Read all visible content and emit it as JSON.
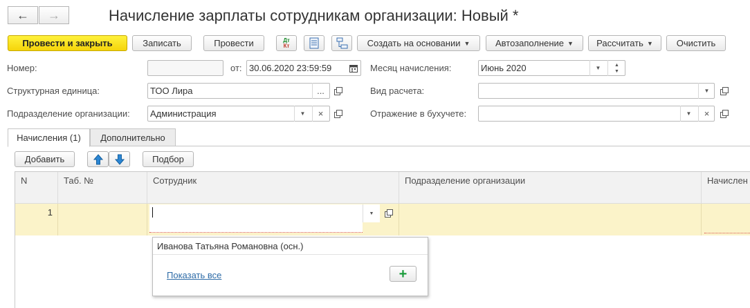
{
  "title": "Начисление зарплаты сотрудникам организации: Новый *",
  "toolbar": {
    "post_close": "Провести и закрыть",
    "save": "Записать",
    "post": "Провести",
    "dt_kt": "Дт Кт",
    "create_based": "Создать на основании",
    "autofill": "Автозаполнение",
    "calculate": "Рассчитать",
    "clear": "Очистить"
  },
  "fields": {
    "number_label": "Номер:",
    "number_value": "",
    "from_label": "от:",
    "date_value": "30.06.2020 23:59:59",
    "month_label": "Месяц начисления:",
    "month_value": "Июнь 2020",
    "unit_label": "Структурная единица:",
    "unit_value": "ТОО Лира",
    "calc_type_label": "Вид расчета:",
    "calc_type_value": "",
    "dept_label": "Подразделение организации:",
    "dept_value": "Администрация",
    "accounting_label": "Отражение в бухучете:",
    "accounting_value": ""
  },
  "tabs": [
    "Начисления (1)",
    "Дополнительно"
  ],
  "table_toolbar": {
    "add": "Добавить",
    "pick": "Подбор"
  },
  "table": {
    "columns": [
      "N",
      "Таб. №",
      "Сотрудник",
      "Подразделение организации",
      "Начислен"
    ],
    "rows": [
      {
        "n": "1",
        "tab_no": "",
        "employee": "",
        "department": "",
        "accrual": ""
      }
    ]
  },
  "dropdown": {
    "item": "Иванова Татьяна Романовна (осн.)",
    "show_all": "Показать все"
  },
  "colors": {
    "primary": "#f5d40a",
    "row_highlight": "#fbf3c9",
    "link": "#2d6ba7",
    "add_icon": "#1a9b3a"
  }
}
